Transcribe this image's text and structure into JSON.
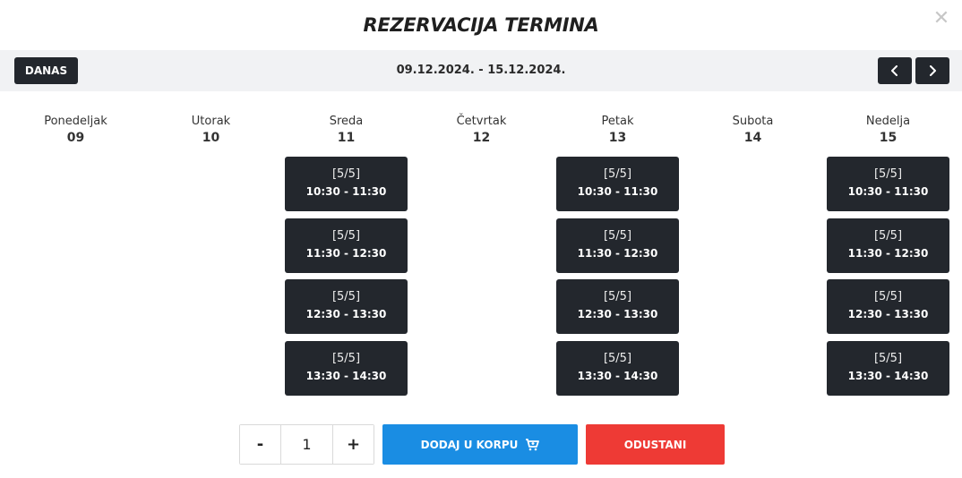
{
  "modal": {
    "title": "REZERVACIJA TERMINA",
    "close_glyph": "✕"
  },
  "toolbar": {
    "today_label": "DANAS",
    "date_range": "09.12.2024. - 15.12.2024.",
    "prev_icon": "chevron-left-icon",
    "next_icon": "chevron-right-icon"
  },
  "days": [
    {
      "name": "Ponedeljak",
      "num": "09",
      "slots": []
    },
    {
      "name": "Utorak",
      "num": "10",
      "slots": []
    },
    {
      "name": "Sreda",
      "num": "11",
      "slots": [
        {
          "capacity": "[5/5]",
          "time": "10:30 - 11:30"
        },
        {
          "capacity": "[5/5]",
          "time": "11:30 - 12:30"
        },
        {
          "capacity": "[5/5]",
          "time": "12:30 - 13:30"
        },
        {
          "capacity": "[5/5]",
          "time": "13:30 - 14:30"
        }
      ]
    },
    {
      "name": "Četvrtak",
      "num": "12",
      "slots": []
    },
    {
      "name": "Petak",
      "num": "13",
      "slots": [
        {
          "capacity": "[5/5]",
          "time": "10:30 - 11:30"
        },
        {
          "capacity": "[5/5]",
          "time": "11:30 - 12:30"
        },
        {
          "capacity": "[5/5]",
          "time": "12:30 - 13:30"
        },
        {
          "capacity": "[5/5]",
          "time": "13:30 - 14:30"
        }
      ]
    },
    {
      "name": "Subota",
      "num": "14",
      "slots": []
    },
    {
      "name": "Nedelja",
      "num": "15",
      "slots": [
        {
          "capacity": "[5/5]",
          "time": "10:30 - 11:30"
        },
        {
          "capacity": "[5/5]",
          "time": "11:30 - 12:30"
        },
        {
          "capacity": "[5/5]",
          "time": "12:30 - 13:30"
        },
        {
          "capacity": "[5/5]",
          "time": "13:30 - 14:30"
        }
      ]
    }
  ],
  "footer": {
    "minus_label": "-",
    "quantity": "1",
    "plus_label": "+",
    "add_label": "DODAJ U KORPU",
    "cart_icon": "cart-icon",
    "cancel_label": "ODUSTANI"
  },
  "colors": {
    "dark": "#23272d",
    "primary": "#1a8de3",
    "danger": "#ee3a35",
    "toolbar_bg": "#f1f2f4"
  }
}
